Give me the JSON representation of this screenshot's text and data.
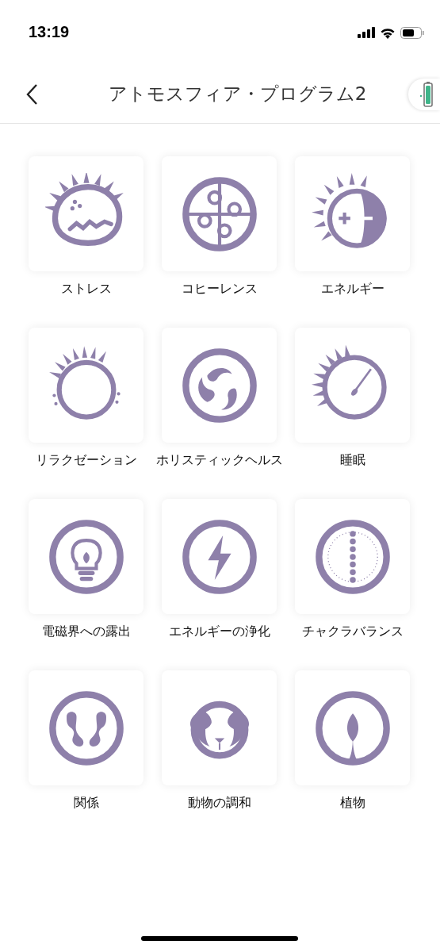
{
  "status_bar": {
    "time": "13:19"
  },
  "nav_bar": {
    "title": "アトモスフィア・プログラム2"
  },
  "programs": [
    {
      "label": "ストレス",
      "kind": "stress"
    },
    {
      "label": "コヒーレンス",
      "kind": "coherence"
    },
    {
      "label": "エネルギー",
      "kind": "energy"
    },
    {
      "label": "リラクゼーション",
      "kind": "relaxation"
    },
    {
      "label": "ホリスティックヘルス",
      "kind": "holistic"
    },
    {
      "label": "睡眠",
      "kind": "sleep"
    },
    {
      "label": "電磁界への露出",
      "kind": "emf"
    },
    {
      "label": "エネルギーの浄化",
      "kind": "purify"
    },
    {
      "label": "チャクラバランス",
      "kind": "chakra"
    },
    {
      "label": "関係",
      "kind": "relationship"
    },
    {
      "label": "動物の調和",
      "kind": "animal"
    },
    {
      "label": "植物",
      "kind": "plant"
    }
  ]
}
